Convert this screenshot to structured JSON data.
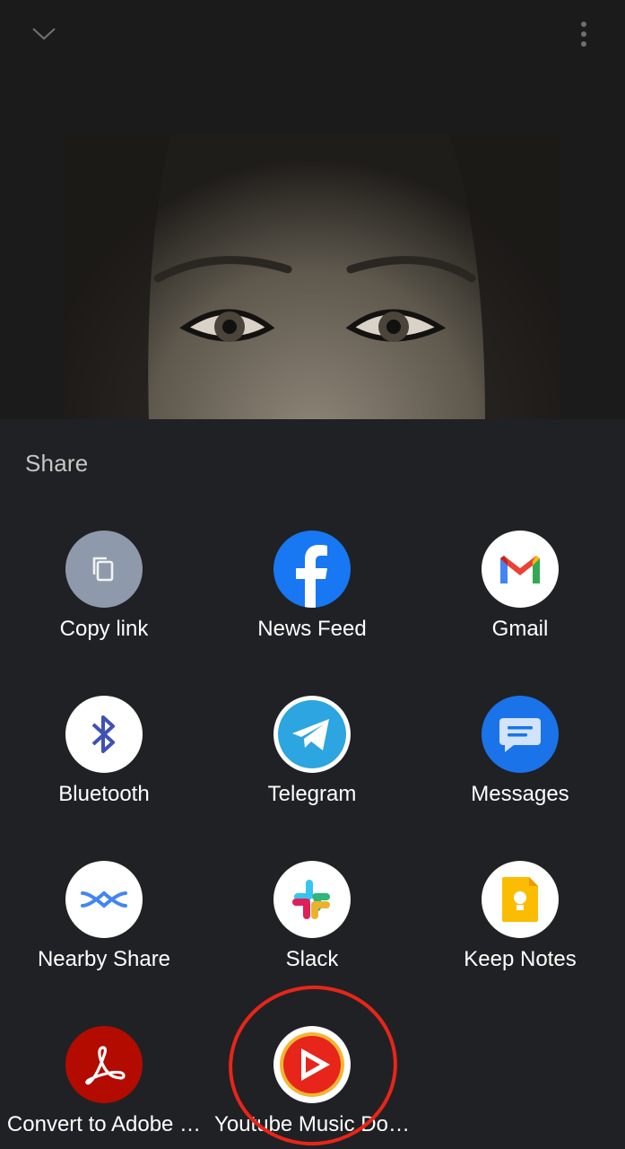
{
  "sheet": {
    "title": "Share",
    "apps": [
      {
        "id": "copy-link",
        "label": "Copy link",
        "icon": "copy-icon",
        "color": "#8e9aab"
      },
      {
        "id": "news-feed",
        "label": "News Feed",
        "icon": "facebook-icon",
        "color": "#1877f2"
      },
      {
        "id": "gmail",
        "label": "Gmail",
        "icon": "gmail-icon",
        "color": "#ffffff"
      },
      {
        "id": "bluetooth",
        "label": "Bluetooth",
        "icon": "bluetooth-icon",
        "color": "#ffffff"
      },
      {
        "id": "telegram",
        "label": "Telegram",
        "icon": "telegram-icon",
        "color": "#2ca5e0"
      },
      {
        "id": "messages",
        "label": "Messages",
        "icon": "messages-icon",
        "color": "#1a73e8"
      },
      {
        "id": "nearby-share",
        "label": "Nearby Share",
        "icon": "nearby-share-icon",
        "color": "#ffffff"
      },
      {
        "id": "slack",
        "label": "Slack",
        "icon": "slack-icon",
        "color": "#ffffff"
      },
      {
        "id": "keep-notes",
        "label": "Keep Notes",
        "icon": "keep-notes-icon",
        "color": "#ffffff"
      },
      {
        "id": "adobe",
        "label": "Convert to Adobe …",
        "icon": "adobe-acrobat-icon",
        "color": "#b30b00"
      },
      {
        "id": "youtube-music-downloader",
        "label": "Youtube Music Do…",
        "icon": "play-icon",
        "color": "#e8251a"
      }
    ]
  },
  "colors": {
    "background": "#1b1b1b",
    "sheet": "#202124",
    "highlight": "#e8251a"
  }
}
